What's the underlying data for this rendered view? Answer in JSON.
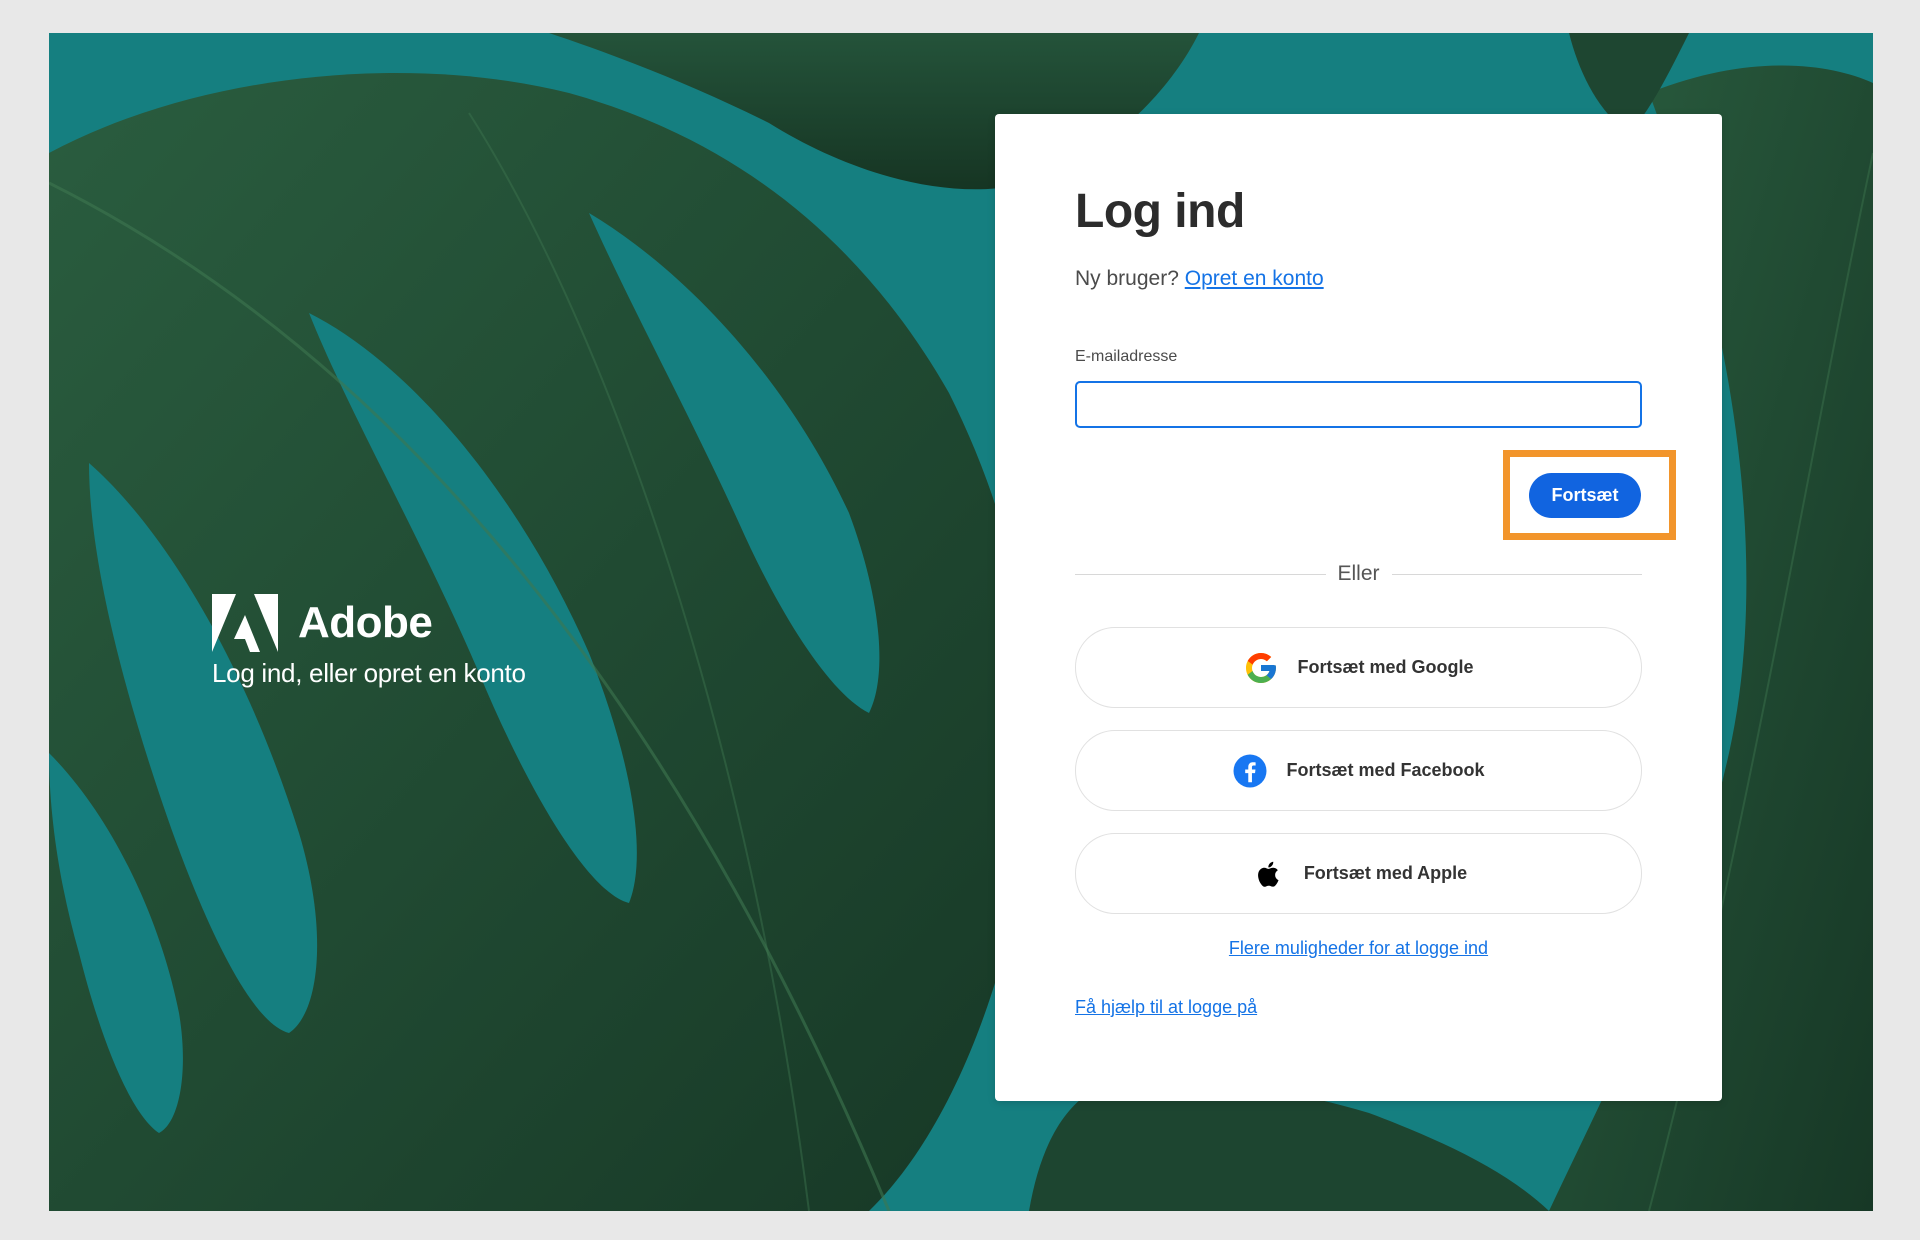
{
  "brand": {
    "name": "Adobe",
    "tagline": "Log ind, eller opret en konto"
  },
  "login": {
    "title": "Log ind",
    "new_user_prefix": "Ny bruger?",
    "create_account_link": "Opret en konto",
    "email_label": "E-mailadresse",
    "email_value": "",
    "continue_label": "Fortsæt",
    "divider_text": "Eller",
    "social": {
      "google": "Fortsæt med Google",
      "facebook": "Fortsæt med Facebook",
      "apple": "Fortsæt med Apple"
    },
    "more_options_link": "Flere muligheder for at logge ind",
    "help_link": "Få hjælp til at logge på"
  },
  "colors": {
    "background_teal": "#157f80",
    "leaf_green": "#1f4a33",
    "accent_blue": "#1473e6",
    "button_blue": "#1164e0",
    "highlight_orange": "#f2952b"
  },
  "icons": {
    "brand": "adobe-logo-icon",
    "google": "google-icon",
    "facebook": "facebook-icon",
    "apple": "apple-icon"
  }
}
